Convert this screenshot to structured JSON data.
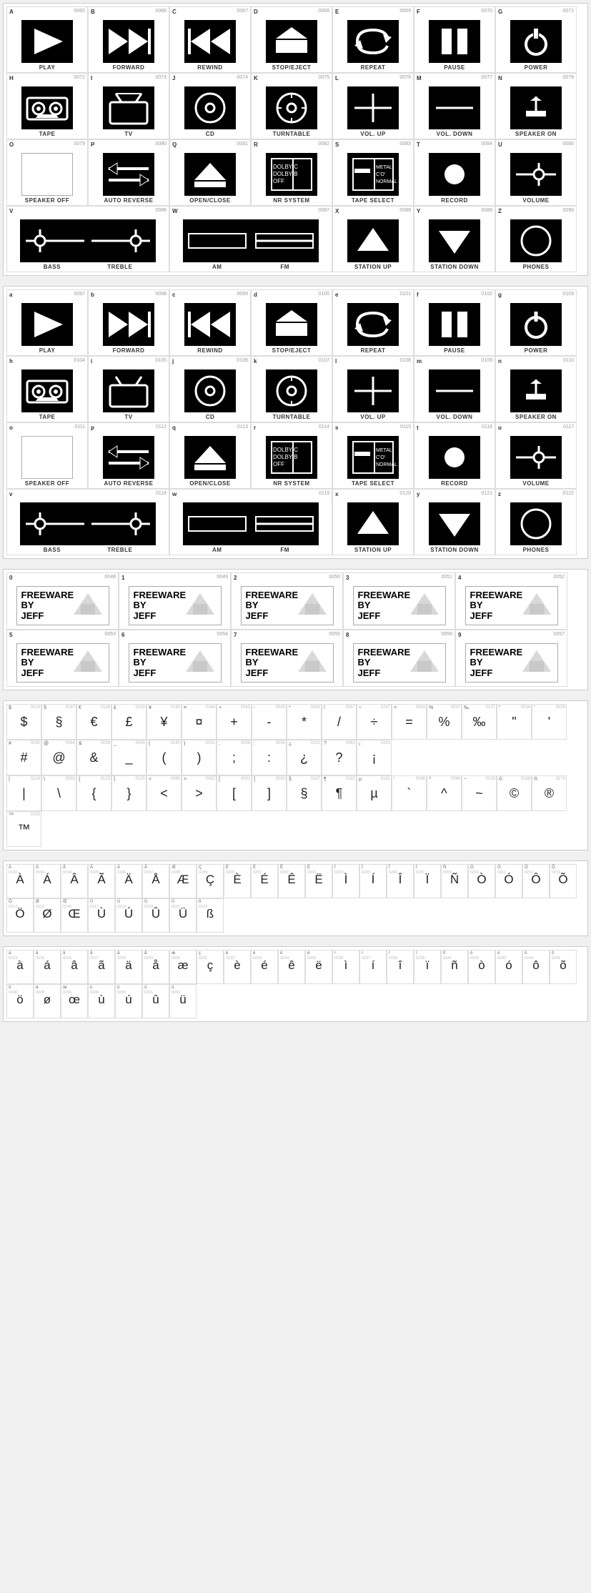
{
  "sections": {
    "uppercase": {
      "rows": [
        {
          "cells": [
            {
              "label": "A",
              "code": "0065",
              "name": "PLAY",
              "icon": "play"
            },
            {
              "label": "B",
              "code": "0066",
              "name": "FORWARD",
              "icon": "forward"
            },
            {
              "label": "C",
              "code": "0067",
              "name": "REWIND",
              "icon": "rewind"
            },
            {
              "label": "D",
              "code": "0068",
              "name": "STOP/EJECT",
              "icon": "stop_eject"
            },
            {
              "label": "E",
              "code": "0069",
              "name": "REPEAT",
              "icon": "repeat"
            },
            {
              "label": "F",
              "code": "0070",
              "name": "PAUSE",
              "icon": "pause"
            },
            {
              "label": "G",
              "code": "0071",
              "name": "POWER",
              "icon": "power"
            }
          ]
        },
        {
          "cells": [
            {
              "label": "H",
              "code": "0072",
              "name": "TAPE",
              "icon": "tape"
            },
            {
              "label": "I",
              "code": "0073",
              "name": "TV",
              "icon": "tv"
            },
            {
              "label": "J",
              "code": "0074",
              "name": "CD",
              "icon": "cd"
            },
            {
              "label": "K",
              "code": "0075",
              "name": "TURNTABLE",
              "icon": "turntable"
            },
            {
              "label": "L",
              "code": "0076",
              "name": "VOL. UP",
              "icon": "vol_up"
            },
            {
              "label": "M",
              "code": "0077",
              "name": "VOL. DOWN",
              "icon": "vol_down"
            },
            {
              "label": "N",
              "code": "0078",
              "name": "SPEAKER ON",
              "icon": "speaker_on"
            }
          ]
        },
        {
          "cells": [
            {
              "label": "O",
              "code": "0079",
              "name": "SPEAKER OFF",
              "icon": "speaker_off"
            },
            {
              "label": "P",
              "code": "0080",
              "name": "AUTO REVERSE",
              "icon": "auto_reverse"
            },
            {
              "label": "Q",
              "code": "0081",
              "name": "OPEN/CLOSE",
              "icon": "open_close"
            },
            {
              "label": "R",
              "code": "0082",
              "name": "NR SYSTEM",
              "icon": "nr_system"
            },
            {
              "label": "S",
              "code": "0083",
              "name": "TAPE SELECT",
              "icon": "tape_select"
            },
            {
              "label": "T",
              "code": "0084",
              "name": "RECORD",
              "icon": "record"
            },
            {
              "label": "U",
              "code": "0085",
              "name": "VOLUME",
              "icon": "volume"
            }
          ]
        },
        {
          "cells": [
            {
              "label": "V",
              "code": "0086",
              "name": "BASS",
              "icon": "bass"
            },
            {
              "label": "",
              "code": "",
              "name": "TREBLE",
              "icon": "treble"
            },
            {
              "label": "W",
              "code": "0087",
              "name": "AM",
              "icon": "am"
            },
            {
              "label": "",
              "code": "",
              "name": "FM",
              "icon": "fm"
            },
            {
              "label": "X",
              "code": "0088",
              "name": "STATION UP",
              "icon": "station_up"
            },
            {
              "label": "Y",
              "code": "0089",
              "name": "STATION DOWN",
              "icon": "station_down"
            },
            {
              "label": "Z",
              "code": "0090",
              "name": "PHONES",
              "icon": "phones"
            }
          ]
        }
      ]
    },
    "lowercase": {
      "rows": [
        {
          "cells": [
            {
              "label": "a",
              "code": "0097",
              "name": "PLAY",
              "icon": "play"
            },
            {
              "label": "b",
              "code": "0098",
              "name": "FORWARD",
              "icon": "forward"
            },
            {
              "label": "c",
              "code": "0099",
              "name": "REWIND",
              "icon": "rewind"
            },
            {
              "label": "d",
              "code": "0100",
              "name": "STOP/EJECT",
              "icon": "stop_eject"
            },
            {
              "label": "e",
              "code": "0101",
              "name": "REPEAT",
              "icon": "repeat"
            },
            {
              "label": "f",
              "code": "0102",
              "name": "PAUSE",
              "icon": "pause"
            },
            {
              "label": "g",
              "code": "0103",
              "name": "POWER",
              "icon": "power"
            }
          ]
        },
        {
          "cells": [
            {
              "label": "h",
              "code": "0104",
              "name": "TAPE",
              "icon": "tape"
            },
            {
              "label": "i",
              "code": "0105",
              "name": "TV",
              "icon": "tv"
            },
            {
              "label": "j",
              "code": "0106",
              "name": "CD",
              "icon": "cd"
            },
            {
              "label": "k",
              "code": "0107",
              "name": "TURNTABLE",
              "icon": "turntable"
            },
            {
              "label": "l",
              "code": "0108",
              "name": "VOL. UP",
              "icon": "vol_up"
            },
            {
              "label": "m",
              "code": "0109",
              "name": "VOL. DOWN",
              "icon": "vol_down"
            },
            {
              "label": "n",
              "code": "0110",
              "name": "SPEAKER ON",
              "icon": "speaker_on"
            }
          ]
        },
        {
          "cells": [
            {
              "label": "o",
              "code": "0111",
              "name": "SPEAKER OFF",
              "icon": "speaker_off"
            },
            {
              "label": "p",
              "code": "0112",
              "name": "AUTO REVERSE",
              "icon": "auto_reverse"
            },
            {
              "label": "q",
              "code": "0113",
              "name": "OPEN/CLOSE",
              "icon": "open_close"
            },
            {
              "label": "r",
              "code": "0114",
              "name": "NR SYSTEM",
              "icon": "nr_system"
            },
            {
              "label": "s",
              "code": "0115",
              "name": "TAPE SELECT",
              "icon": "tape_select"
            },
            {
              "label": "t",
              "code": "0116",
              "name": "RECORD",
              "icon": "record"
            },
            {
              "label": "u",
              "code": "0117",
              "name": "VOLUME",
              "icon": "volume"
            }
          ]
        },
        {
          "cells": [
            {
              "label": "v",
              "code": "0118",
              "name": "BASS",
              "icon": "bass"
            },
            {
              "label": "",
              "code": "",
              "name": "TREBLE",
              "icon": "treble"
            },
            {
              "label": "w",
              "code": "0119",
              "name": "AM",
              "icon": "am"
            },
            {
              "label": "",
              "code": "",
              "name": "FM",
              "icon": "fm"
            },
            {
              "label": "x",
              "code": "0120",
              "name": "STATION UP",
              "icon": "station_up"
            },
            {
              "label": "y",
              "code": "0121",
              "name": "STATION DOWN",
              "icon": "station_down"
            },
            {
              "label": "z",
              "code": "0122",
              "name": "PHONES",
              "icon": "phones"
            }
          ]
        }
      ]
    },
    "numbers": {
      "rows": [
        {
          "cells": [
            {
              "label": "0",
              "code": "0048",
              "name": "FREEWARE"
            },
            {
              "label": "1",
              "code": "0049",
              "name": "FREEWARE"
            },
            {
              "label": "2",
              "code": "0050",
              "name": "FREEWARE"
            },
            {
              "label": "3",
              "code": "0051",
              "name": "FREEWARE"
            },
            {
              "label": "4",
              "code": "0052",
              "name": "FREEWARE"
            }
          ]
        },
        {
          "cells": [
            {
              "label": "5",
              "code": "0053",
              "name": "FREEWARE"
            },
            {
              "label": "6",
              "code": "0054",
              "name": "FREEWARE"
            },
            {
              "label": "7",
              "code": "0055",
              "name": "FREEWARE"
            },
            {
              "label": "8",
              "code": "0056",
              "name": "FREEWARE"
            },
            {
              "label": "9",
              "code": "0057",
              "name": "FREEWARE"
            }
          ]
        }
      ]
    }
  }
}
